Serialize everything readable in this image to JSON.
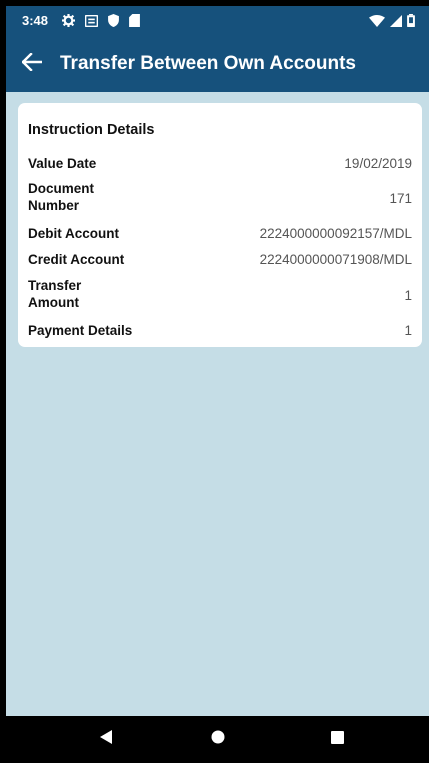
{
  "status_bar": {
    "time": "3:48",
    "left_icons": [
      "gear-icon",
      "notification-icon",
      "shield-icon",
      "sd-card-icon"
    ],
    "right_icons": [
      "wifi-icon",
      "signal-icon",
      "battery-icon"
    ]
  },
  "app_bar": {
    "back_icon": "arrow-left-icon",
    "title": "Transfer Between Own Accounts"
  },
  "instruction_details": {
    "title": "Instruction Details",
    "rows": [
      {
        "label": "Value Date",
        "value": "19/02/2019"
      },
      {
        "label": "Document\nNumber",
        "value": "171"
      },
      {
        "label": "Debit Account",
        "value": "2224000000092157/MDL"
      },
      {
        "label": "Credit Account",
        "value": "2224000000071908/MDL"
      },
      {
        "label": "Transfer\nAmount",
        "value": "1"
      },
      {
        "label": "Payment Details",
        "value": "1"
      }
    ]
  },
  "nav_bar": {
    "back_icon": "nav-back-icon",
    "home_icon": "nav-home-icon",
    "recents_icon": "nav-recents-icon"
  },
  "colors": {
    "header": "#16517c",
    "background": "#c5dde6",
    "card": "#ffffff"
  }
}
